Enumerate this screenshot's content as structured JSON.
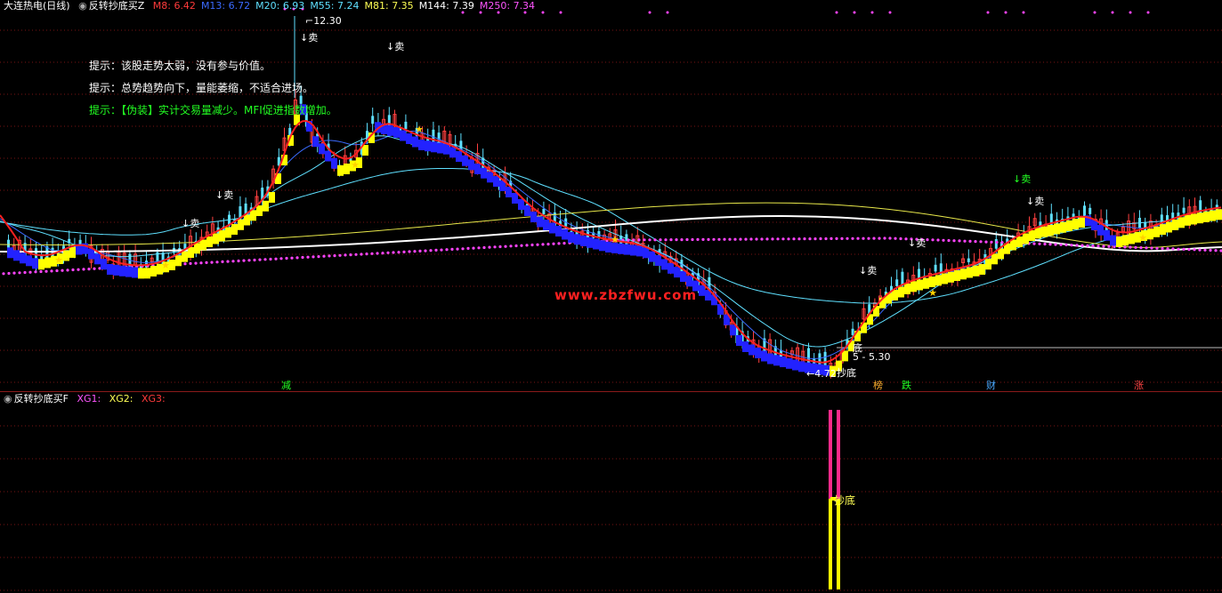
{
  "main_header": {
    "stock": "大连热电",
    "period": "(日线)",
    "indicator": "反转抄底买Z",
    "ma": [
      {
        "label": "M8: 6.42",
        "color": "#ff3b3b"
      },
      {
        "label": "M13: 6.72",
        "color": "#3b6bff"
      },
      {
        "label": "M20: 6.93",
        "color": "#5fe0ff"
      },
      {
        "label": "M55: 7.24",
        "color": "#5fe0ff"
      },
      {
        "label": "M81: 7.35",
        "color": "#ffff55"
      },
      {
        "label": "M144: 7.39",
        "color": "#ffffff"
      },
      {
        "label": "M250: 7.34",
        "color": "#ff55ff"
      }
    ]
  },
  "tips": [
    "提示：该股走势太弱，没有参与价值。",
    "提示：总势趋势向下，量能萎缩，不适合进场。",
    "提示：【伪装】实计交易量减少。MFI促进指数增加。"
  ],
  "labels": {
    "high": "12.30",
    "low": "4.72",
    "range": "5 - 5.30",
    "sell": "↓卖",
    "bottom": "抄底",
    "bottom_short": "底",
    "watermark": "www.zbzfwu.com"
  },
  "markers": [
    {
      "text": "减",
      "color": "#22ff22"
    },
    {
      "text": "榜",
      "color": "#ffb02e"
    },
    {
      "text": "跌",
      "color": "#22ff22"
    },
    {
      "text": "财",
      "color": "#4aa8ff"
    },
    {
      "text": "涨",
      "color": "#ff4444"
    }
  ],
  "sub_header": {
    "indicator": "反转抄底买F",
    "xg1": "XG1:",
    "xg2": "XG2:",
    "xg3": "XG3:"
  },
  "sub_label": "抄底"
}
